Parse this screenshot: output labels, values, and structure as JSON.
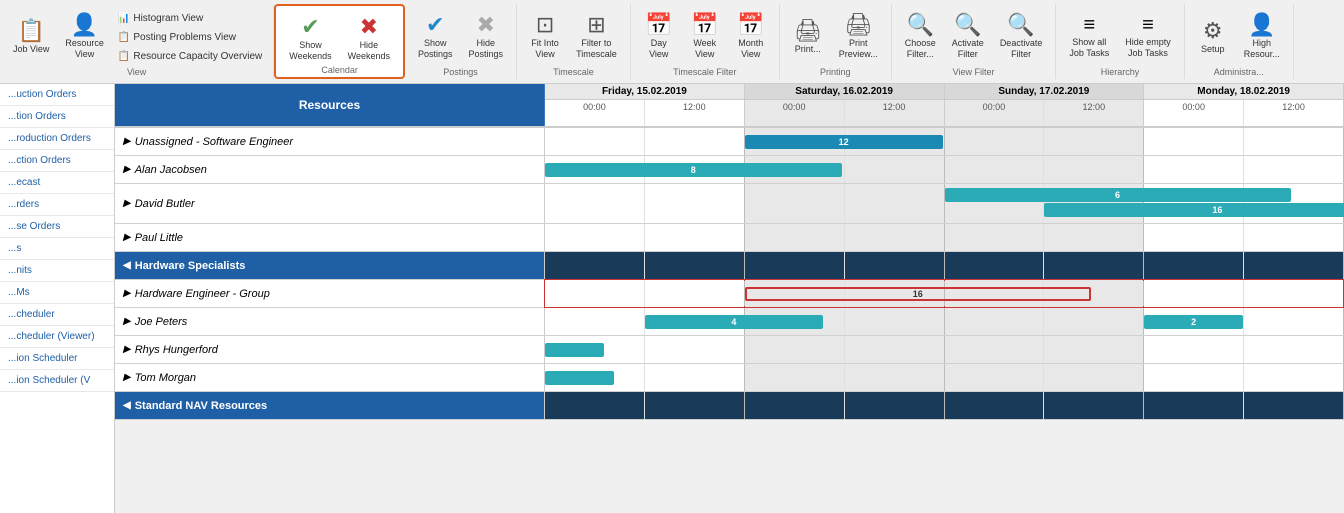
{
  "toolbar": {
    "groups": [
      {
        "name": "view",
        "label": "View",
        "buttons": [
          {
            "id": "job-view",
            "icon": "📋",
            "label": "Job\nView",
            "large": true
          },
          {
            "id": "resource-view",
            "icon": "👤",
            "label": "Resource\nView",
            "large": true
          },
          {
            "id": "view-submenu",
            "small": true,
            "items": [
              {
                "id": "histogram-view",
                "icon": "📊",
                "label": "Histogram View"
              },
              {
                "id": "posting-problems-view",
                "icon": "📋",
                "label": "Posting Problems View"
              },
              {
                "id": "resource-capacity-overview",
                "icon": "📋",
                "label": "Resource Capacity Overview"
              }
            ]
          }
        ]
      },
      {
        "name": "calendar",
        "label": "Calendar",
        "active": true,
        "buttons": [
          {
            "id": "show-weekends",
            "icon": "✔",
            "iconClass": "icon-check",
            "label": "Show\nWeekends",
            "large": true
          },
          {
            "id": "hide-weekends",
            "icon": "✖",
            "iconClass": "icon-x",
            "label": "Hide\nWeekends",
            "large": true
          }
        ]
      },
      {
        "name": "postings",
        "label": "Postings",
        "buttons": [
          {
            "id": "show-postings",
            "icon": "✔",
            "iconClass": "icon-check-blue",
            "label": "Show\nPostings",
            "large": true
          },
          {
            "id": "hide-postings",
            "icon": "✖",
            "iconClass": "icon-x-gray",
            "label": "Hide\nPostings",
            "large": true
          }
        ]
      },
      {
        "name": "timescale",
        "label": "Timescale",
        "buttons": [
          {
            "id": "fit-into-view",
            "icon": "⊡",
            "label": "Fit Into\nView",
            "large": true
          },
          {
            "id": "filter-to-timescale",
            "icon": "⊞",
            "label": "Filter to\nTimescale",
            "large": true
          }
        ]
      },
      {
        "name": "timescale-filter",
        "label": "Timescale Filter",
        "buttons": [
          {
            "id": "day-view",
            "icon": "📅",
            "label": "Day\nView",
            "large": true
          },
          {
            "id": "week-view",
            "icon": "📅",
            "label": "Week\nView",
            "large": true
          },
          {
            "id": "month-view",
            "icon": "📅",
            "label": "Month\nView",
            "large": true
          }
        ]
      },
      {
        "name": "printing",
        "label": "Printing",
        "buttons": [
          {
            "id": "print",
            "icon": "🖨",
            "label": "Print...",
            "large": true
          },
          {
            "id": "print-preview",
            "icon": "🖨",
            "label": "Print\nPreview...",
            "large": true
          }
        ]
      },
      {
        "name": "view-filter",
        "label": "View Filter",
        "buttons": [
          {
            "id": "choose-filter",
            "icon": "🔍",
            "label": "Choose\nFilter...",
            "large": true
          },
          {
            "id": "activate-filter",
            "icon": "🔍",
            "label": "Activate\nFilter",
            "large": true
          },
          {
            "id": "deactivate-filter",
            "icon": "🔍",
            "label": "Deactivate\nFilter",
            "large": true
          }
        ]
      },
      {
        "name": "hierarchy",
        "label": "Hierarchy",
        "buttons": [
          {
            "id": "show-all-job-tasks",
            "icon": "≡",
            "label": "Show all\nJob Tasks",
            "large": true
          },
          {
            "id": "hide-empty-job-tasks",
            "icon": "≡",
            "label": "Hide empty\nJob Tasks",
            "large": true
          }
        ]
      },
      {
        "name": "administra",
        "label": "Administra...",
        "buttons": [
          {
            "id": "setup",
            "icon": "⚙",
            "label": "Setup",
            "large": true
          },
          {
            "id": "high-resource",
            "icon": "👤",
            "label": "High\nResour...",
            "large": true
          }
        ]
      }
    ]
  },
  "sidebar": {
    "items": [
      {
        "id": "production-orders-1",
        "label": "...uction Orders"
      },
      {
        "id": "production-orders-2",
        "label": "...tion Orders"
      },
      {
        "id": "production-orders-3",
        "label": "...roduction Orders"
      },
      {
        "id": "production-orders-4",
        "label": "...ction Orders"
      },
      {
        "id": "forecast",
        "label": "...ecast"
      },
      {
        "id": "orders",
        "label": "...rders"
      },
      {
        "id": "se-orders",
        "label": "...se Orders"
      },
      {
        "id": "s",
        "label": "...s"
      },
      {
        "id": "units",
        "label": "...nits"
      },
      {
        "id": "ms",
        "label": "...Ms"
      },
      {
        "id": "scheduler",
        "label": "...cheduler"
      },
      {
        "id": "scheduler-viewer",
        "label": "...cheduler (Viewer)"
      },
      {
        "id": "ion-scheduler",
        "label": "...ion Scheduler"
      },
      {
        "id": "ion-scheduler-v",
        "label": "...ion Scheduler (V"
      }
    ]
  },
  "resources_header": "Resources",
  "dates": [
    {
      "label": "Friday, 15.02.2019",
      "weekend": false,
      "times": [
        "00:00",
        "12:00"
      ]
    },
    {
      "label": "Saturday, 16.02.2019",
      "weekend": true,
      "times": [
        "00:00",
        "12:00"
      ]
    },
    {
      "label": "Sunday, 17.02.2019",
      "weekend": true,
      "times": [
        "00:00",
        "12:00"
      ]
    },
    {
      "label": "Monday, 18.02.2019",
      "weekend": false,
      "times": [
        "00:00",
        "12:00"
      ]
    }
  ],
  "resource_rows": [
    {
      "id": "unassigned-sw",
      "type": "item",
      "name": "Unassigned - Software Engineer",
      "bars": [
        {
          "day": 1,
          "half": 1,
          "width": "100%",
          "left": "0%",
          "class": "blue",
          "label": "12"
        }
      ]
    },
    {
      "id": "alan-jacobsen",
      "type": "item",
      "name": "Alan Jacobsen",
      "bars": [
        {
          "day": 0,
          "half": 0,
          "width": "180%",
          "left": "0%",
          "class": "teal",
          "label": "8"
        }
      ]
    },
    {
      "id": "david-butler",
      "type": "item",
      "name": "David Butler",
      "bars": [
        {
          "day": 2,
          "half": 0,
          "width": "180%",
          "left": "0%",
          "class": "teal",
          "label": "6"
        },
        {
          "day": 2,
          "half": 1,
          "width": "100%",
          "left": "0%",
          "class": "teal",
          "label": "16"
        }
      ]
    },
    {
      "id": "paul-little",
      "type": "item",
      "name": "Paul Little",
      "bars": []
    },
    {
      "id": "hardware-specialists",
      "type": "group",
      "name": "Hardware Specialists",
      "bars": []
    },
    {
      "id": "hardware-engineer-group",
      "type": "item",
      "name": "Hardware Engineer - Group",
      "bars": [
        {
          "day": 1,
          "half": 0,
          "width": "200%",
          "left": "0%",
          "class": "red-outline",
          "label": "16"
        }
      ],
      "highlighted": true
    },
    {
      "id": "joe-peters",
      "type": "item",
      "name": "Joe Peters",
      "bars": [
        {
          "day": 0,
          "half": 1,
          "width": "100%",
          "left": "0%",
          "class": "teal",
          "label": "4"
        },
        {
          "day": 3,
          "half": 0,
          "width": "100%",
          "left": "0%",
          "class": "teal",
          "label": "2"
        }
      ]
    },
    {
      "id": "rhys-hungerford",
      "type": "item",
      "name": "Rhys Hungerford",
      "bars": [
        {
          "day": 0,
          "half": 0,
          "width": "50%",
          "left": "0%",
          "class": "teal",
          "label": ""
        }
      ]
    },
    {
      "id": "tom-morgan",
      "type": "item",
      "name": "Tom Morgan",
      "bars": [
        {
          "day": 0,
          "half": 0,
          "width": "60%",
          "left": "0%",
          "class": "teal",
          "label": ""
        }
      ]
    },
    {
      "id": "standard-nav-resources",
      "type": "group",
      "name": "Standard NAV Resources",
      "bars": []
    }
  ]
}
